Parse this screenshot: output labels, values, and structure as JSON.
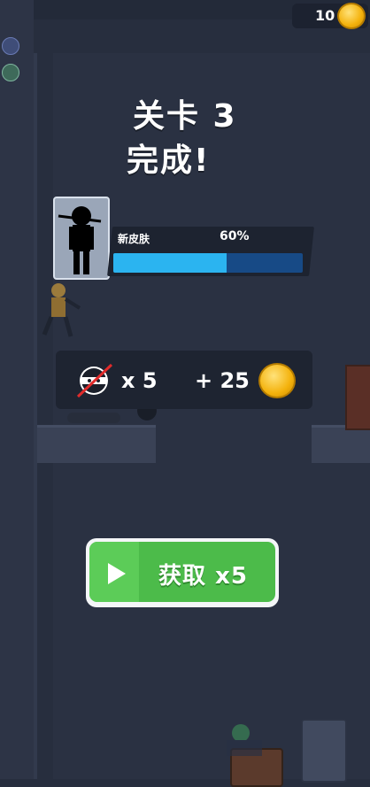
{
  "top_bar": {
    "coin_count": "10"
  },
  "level": {
    "line1": "关卡 3",
    "line2": "完成!"
  },
  "skin_progress": {
    "label": "新皮肤",
    "percent_text": "60%",
    "progress": 0.6
  },
  "reward": {
    "multiplier_text": "x 5",
    "coin_bonus_text": "+ 25"
  },
  "claim_button": {
    "label": "获取 x5"
  },
  "colors": {
    "accent_blue": "#2bb4f0",
    "button_green": "#4cbb4a",
    "coin_gold": "#f4b20c",
    "background": "#272e3e"
  }
}
